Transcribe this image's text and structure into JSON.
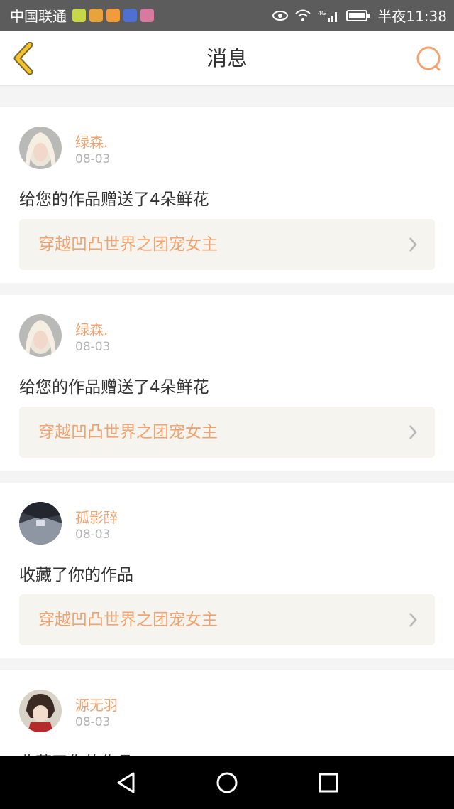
{
  "status_bar": {
    "carrier": "中国联通",
    "time": "半夜11:38",
    "network": "4G"
  },
  "nav": {
    "title": "消息"
  },
  "messages": [
    {
      "user": "绿森.",
      "date": "08-03",
      "action": "给您的作品赠送了4朵鲜花",
      "work": "穿越凹凸世界之团宠女主"
    },
    {
      "user": "绿森.",
      "date": "08-03",
      "action": "给您的作品赠送了4朵鲜花",
      "work": "穿越凹凸世界之团宠女主"
    },
    {
      "user": "孤影醉",
      "date": "08-03",
      "action": "收藏了你的作品",
      "work": "穿越凹凸世界之团宠女主"
    },
    {
      "user": "源无羽",
      "date": "08-03",
      "action": "收藏了你的作品",
      "work": ""
    }
  ],
  "colors": {
    "accent": "#f0a371",
    "back_arrow": "#f2c232"
  },
  "icons": {
    "back": "chevron-left-icon",
    "search": "search-icon",
    "arrow": "chevron-right-icon"
  }
}
